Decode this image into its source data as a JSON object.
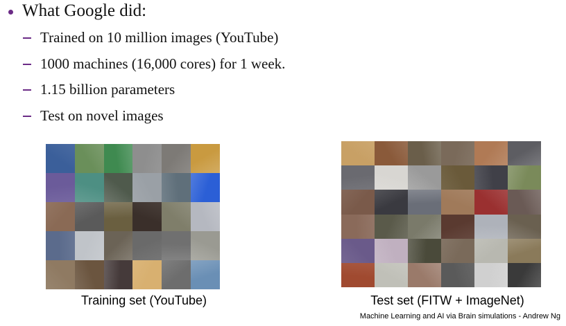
{
  "slide": {
    "heading": "What Google did:",
    "bullets": [
      "Trained on 10 million images (YouTube)",
      "1000 machines (16,000 cores) for 1 week.",
      "1.15 billion parameters",
      "Test on novel images"
    ],
    "training_caption": "Training set (YouTube)",
    "test_caption": "Test set (FITW + ImageNet)",
    "footer": "Machine Learning and AI via Brain simulations - Andrew Ng",
    "accent_color": "#6b2b86",
    "training_colors": [
      "#3b5f9a",
      "#6a8f5a",
      "#3f8a50",
      "#8e8e8e",
      "#7d7a76",
      "#c99a40",
      "#6b5b9a",
      "#4d8f83",
      "#4f5a4c",
      "#9aa0a6",
      "#5f6f7a",
      "#2b5fd6",
      "#8a6a55",
      "#5a5a5a",
      "#6a5f40",
      "#3a2f2a",
      "#7f7e6a",
      "#b5b8c0",
      "#5b6b8c",
      "#c0c4c9",
      "#6b6356",
      "#6a6a6a",
      "#707070",
      "#9a9a92",
      "#8f7a62",
      "#6b553f",
      "#453a3a",
      "#d8b070",
      "#6d6d6d",
      "#6a8fb5"
    ],
    "test_colors": [
      "#c8a065",
      "#8a5a3a",
      "#6a5e4a",
      "#7a6a5a",
      "#b07a55",
      "#5d5d62",
      "#6a6a70",
      "#d8d6d2",
      "#9a9a9a",
      "#6a5a3a",
      "#404048",
      "#7a8a5a",
      "#7a5a4a",
      "#3a3a40",
      "#6a6e78",
      "#a07a5a",
      "#9a3030",
      "#6a5a55",
      "#8a6a5a",
      "#5a5a4a",
      "#7a7a6a",
      "#5a3a30",
      "#aeb2ba",
      "#6a6050",
      "#6a5a8a",
      "#c0b0c0",
      "#4a4a3a",
      "#7a6a5a",
      "#b8b8b0",
      "#8a7a5a",
      "#a04a30",
      "#c0c0b8",
      "#9a7a6a",
      "#5a5a5a",
      "#d0d0d0",
      "#3a3a3a"
    ]
  }
}
